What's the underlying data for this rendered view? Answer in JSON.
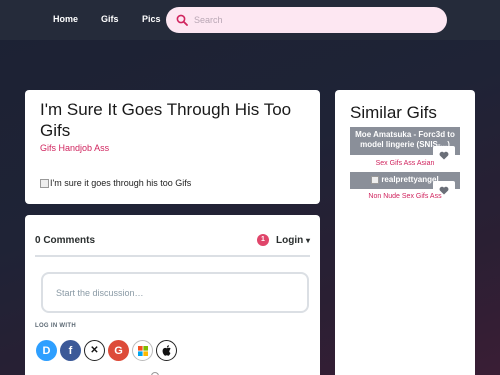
{
  "nav": {
    "items": [
      "Home",
      "Gifs",
      "Pics"
    ],
    "search_placeholder": "Search"
  },
  "main": {
    "title": "I'm Sure It Goes Through His Too Gifs",
    "tags": [
      "Gifs",
      "Handjob",
      "Ass"
    ],
    "image_alt": "I'm sure it goes through his too Gifs"
  },
  "sidebar": {
    "title": "Similar Gifs",
    "items": [
      {
        "thumb_text": "Moe Amatsuka - Forc3d to model lingerie (SNIS-...)",
        "tags": "Sex Gifs Ass Asian"
      },
      {
        "thumb_text": "realprettyangel",
        "tags": "Non Nude Sex Gifs Ass"
      }
    ]
  },
  "comments": {
    "count_label": "0 Comments",
    "badge": "1",
    "login_label": "Login",
    "placeholder": "Start the discussion…",
    "login_with": "LOG IN WITH",
    "providers": [
      {
        "icon": "disqus-icon",
        "glyph": "D",
        "color": "#2e9fff"
      },
      {
        "icon": "facebook-icon",
        "glyph": "f",
        "color": "#3b5998"
      },
      {
        "icon": "x-icon",
        "glyph": "𝕏",
        "color": "#ffffff"
      },
      {
        "icon": "google-icon",
        "glyph": "G",
        "color": "#dd4b39"
      },
      {
        "icon": "microsoft-icon",
        "glyph": "",
        "color": "#ffffff"
      },
      {
        "icon": "apple-icon",
        "glyph": "",
        "color": "#ffffff"
      }
    ]
  },
  "colors": {
    "accent": "#d0245e",
    "topbar": "#252b3a",
    "search_bg": "#fde7f2"
  }
}
